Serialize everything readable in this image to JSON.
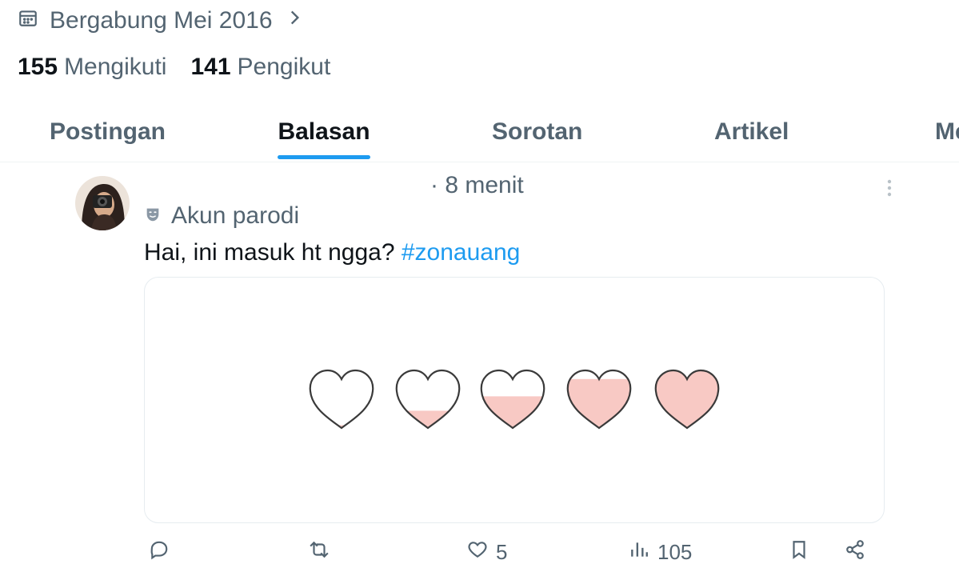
{
  "profile": {
    "joined_text": "Bergabung Mei 2016",
    "following_count": "155",
    "following_label": "Mengikuti",
    "followers_count": "141",
    "followers_label": "Pengikut"
  },
  "tabs": [
    {
      "label": "Postingan",
      "active": false
    },
    {
      "label": "Balasan",
      "active": true
    },
    {
      "label": "Sorotan",
      "active": false
    },
    {
      "label": "Artikel",
      "active": false
    },
    {
      "label": "Me",
      "active": false
    }
  ],
  "post": {
    "time": "· 8 menit",
    "parody_label": "Akun parodi",
    "text": "Hai, ini masuk ht ngga?",
    "hashtag": "#zonauang",
    "media": {
      "description_icons": "heart-icon",
      "heart_fill_levels": [
        0.05,
        0.3,
        0.55,
        0.85,
        1.0
      ],
      "fill_color": "#f8c9c4"
    },
    "actions": {
      "reply_count": "",
      "retweet_count": "",
      "like_count": "5",
      "views_count": "105"
    }
  },
  "colors": {
    "accent": "#1d9bf0",
    "secondary_text": "#536471",
    "primary_text": "#0f1419"
  }
}
